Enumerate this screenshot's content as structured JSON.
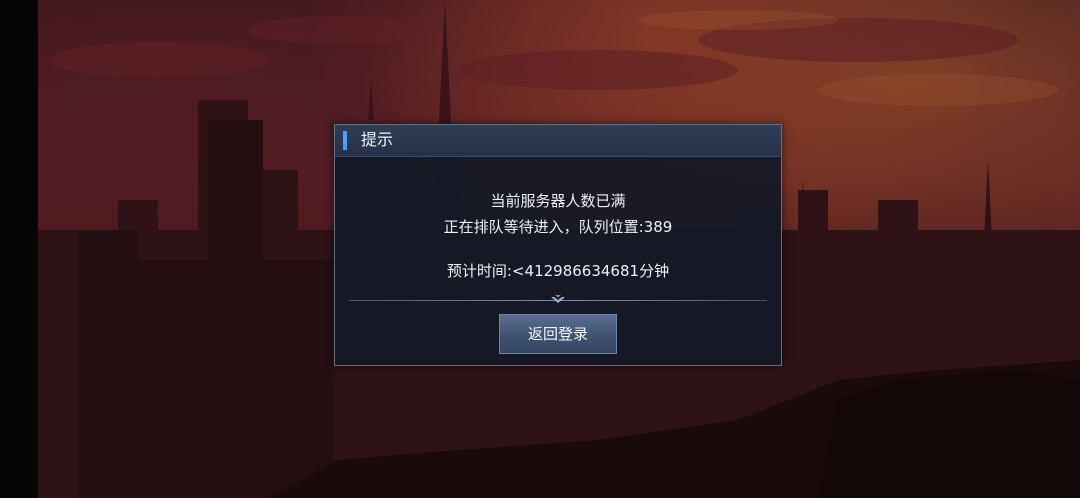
{
  "dialog": {
    "title": "提示",
    "line1": "当前服务器人数已满",
    "line2": "正在排队等待进入，队列位置:389",
    "line3": "预计时间:<412986634681分钟",
    "button_label": "返回登录"
  },
  "colors": {
    "accent": "#4ba0ff",
    "dialog_bg": "#141a26",
    "button_bg": "#3f5272",
    "sky": "#6b2328"
  },
  "icons": {
    "divider_ornament": "chevron-down-ornament-icon"
  }
}
